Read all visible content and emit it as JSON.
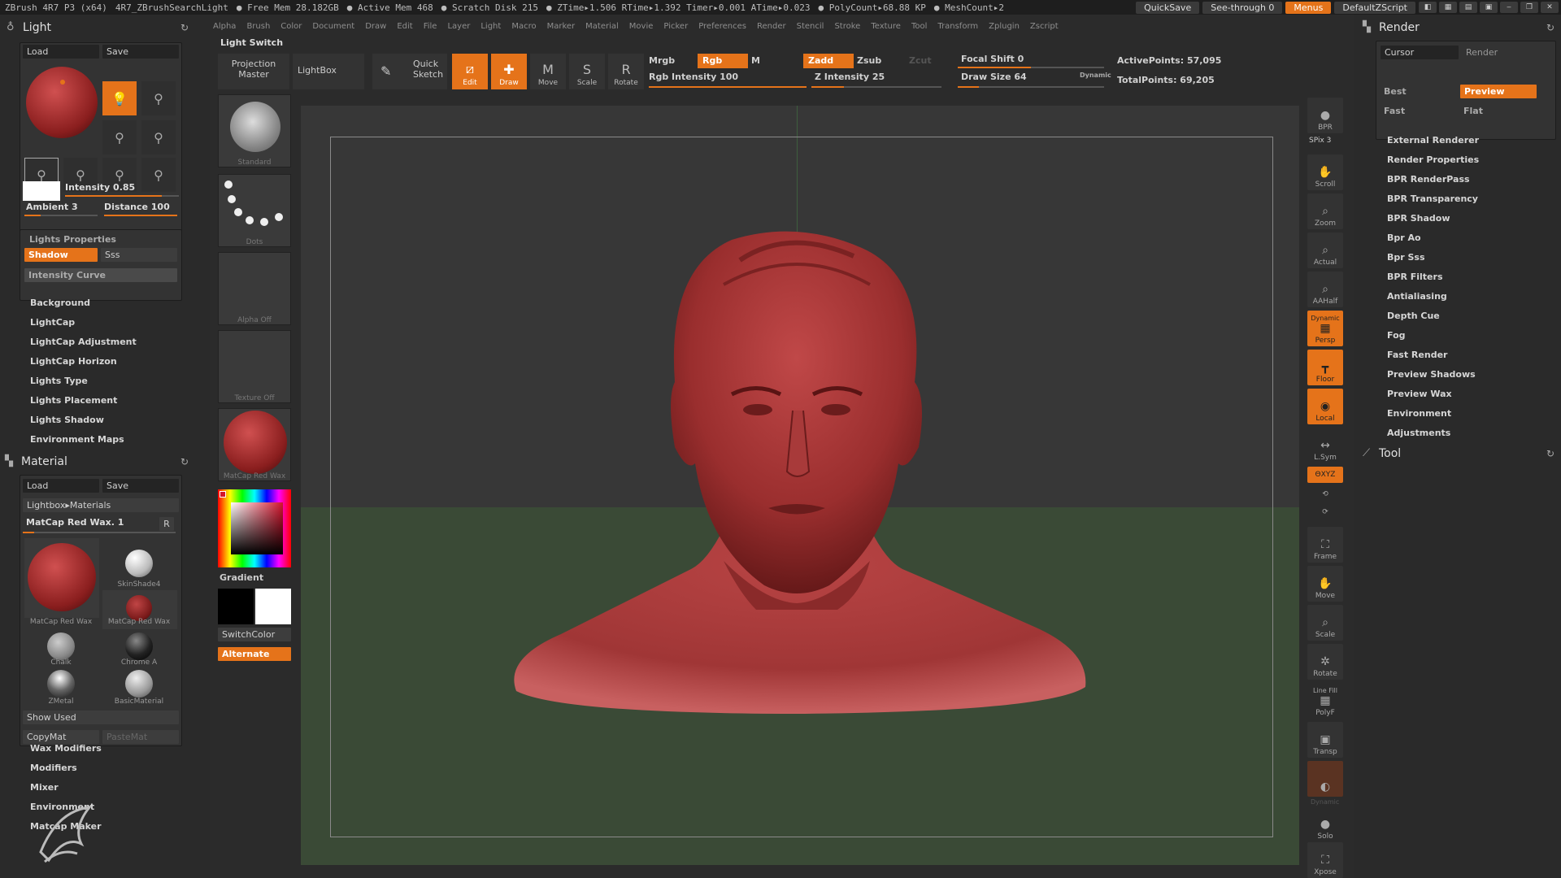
{
  "titlebar": {
    "stats": [
      "ZBrush 4R7 P3 (x64)",
      "4R7_ZBrushSearchLight",
      "● Free Mem 28.182GB",
      "● Active Mem 468",
      "● Scratch Disk 215",
      "● ZTime▸1.506 RTime▸1.392 Timer▸0.001 ATime▸0.023",
      "● PolyCount▸68.88 KP",
      "● MeshCount▸2"
    ],
    "quicksave": "QuickSave",
    "seethrough": "See-through  0",
    "menus": "Menus",
    "script": "DefaultZScript"
  },
  "menubar": [
    "Alpha",
    "Brush",
    "Color",
    "Document",
    "Draw",
    "Edit",
    "File",
    "Layer",
    "Light",
    "Macro",
    "Marker",
    "Material",
    "Movie",
    "Picker",
    "Preferences",
    "Render",
    "Stencil",
    "Stroke",
    "Texture",
    "Tool",
    "Transform",
    "Zplugin",
    "Zscript"
  ],
  "light": {
    "title": "Light",
    "load": "Load",
    "save": "Save",
    "intensity": "Intensity 0.85",
    "ambient": "Ambient 3",
    "distance": "Distance 100",
    "properties": "Lights Properties",
    "shadow": "Shadow",
    "sss": "Sss",
    "intensity_curve": "Intensity Curve",
    "submenus": [
      "Background",
      "LightCap",
      "LightCap Adjustment",
      "LightCap Horizon",
      "Lights Type",
      "Lights Placement",
      "Lights Shadow",
      "Environment Maps"
    ]
  },
  "material": {
    "title": "Material",
    "load": "Load",
    "save": "Save",
    "lightbox": "Lightbox▸Materials",
    "current": "MatCap Red Wax. 1",
    "r": "R",
    "swatches": [
      "MatCap Red Wax",
      "SkinShade4",
      "MatCap Red Wax",
      "Chalk",
      "Chrome A",
      "ZMetal",
      "BasicMaterial"
    ],
    "show_used": "Show Used",
    "copymat": "CopyMat",
    "pastemat": "PasteMat",
    "submenus": [
      "Wax Modifiers",
      "Modifiers",
      "Mixer",
      "Environment",
      "Matcap Maker"
    ]
  },
  "header": {
    "light_switch": "Light Switch"
  },
  "toolbar": {
    "projection_master": "Projection Master",
    "lightbox": "LightBox",
    "quick_sketch": "Quick Sketch",
    "edit": "Edit",
    "draw": "Draw",
    "move": "Move",
    "scale": "Scale",
    "rotate": "Rotate",
    "mrgb": "Mrgb",
    "rgb": "Rgb",
    "m": "M",
    "rgb_intensity": "Rgb Intensity 100",
    "zadd": "Zadd",
    "zsub": "Zsub",
    "zcut": "Zcut",
    "z_intensity": "Z Intensity 25",
    "focal_shift": "Focal Shift 0",
    "draw_size": "Draw Size 64",
    "dynamic": "Dynamic",
    "active_points": "ActivePoints: 57,095",
    "total_points": "TotalPoints: 69,205"
  },
  "col2": {
    "standard": "Standard",
    "dots": "Dots",
    "alpha_off": "Alpha  Off",
    "texture_off": "Texture  Off",
    "matcap": "MatCap  Red  Wax",
    "gradient": "Gradient",
    "switchcolor": "SwitchColor",
    "alternate": "Alternate"
  },
  "dock": {
    "bpr": "BPR",
    "spix": "SPix 3",
    "scroll": "Scroll",
    "zoom": "Zoom",
    "actual": "Actual",
    "aahalf": "AAHalf",
    "dynamic": "Dynamic",
    "persp": "Persp",
    "floor": "Floor",
    "local": "Local",
    "lsym": "L.Sym",
    "xyz": "ΘXYZ",
    "frame": "Frame",
    "move": "Move",
    "scale": "Scale",
    "rotate": "Rotate",
    "linefill": "Line Fill",
    "polyf": "PolyF",
    "transp": "Transp",
    "dynamic2": "Dynamic",
    "solo": "Solo",
    "xpose": "Xpose"
  },
  "render": {
    "title": "Render",
    "cursor": "Cursor",
    "render": "Render",
    "best": "Best",
    "preview": "Preview",
    "fast": "Fast",
    "flat": "Flat",
    "items": [
      "External Renderer",
      "Render Properties",
      "BPR  RenderPass",
      "BPR  Transparency",
      "BPR  Shadow",
      "Bpr  Ao",
      "Bpr  Sss",
      "BPR  Filters",
      "Antialiasing",
      "Depth  Cue",
      "Fog",
      "Fast  Render",
      "Preview  Shadows",
      "Preview  Wax",
      "Environment",
      "Adjustments"
    ],
    "tool": "Tool"
  },
  "colors": {
    "accent": "#e5731a",
    "clay": "#a23a3a"
  }
}
